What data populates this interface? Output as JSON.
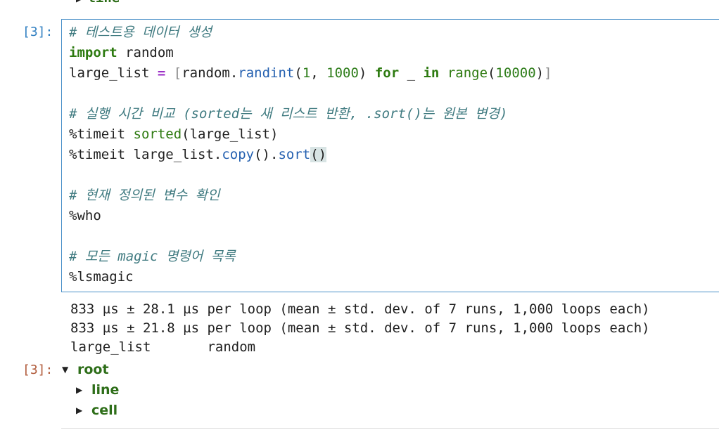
{
  "prev_output": {
    "tree_item": "line"
  },
  "input_cell": {
    "prompt": "[3]:",
    "code": {
      "l1_comment": "# 테스트용 데이터 생성",
      "l2_kw": "import",
      "l2_rest": " random",
      "l3_var": "large_list ",
      "l3_op": "=",
      "l3_a": " ",
      "l3_br_open": "[",
      "l3_b": "random.",
      "l3_fn": "randint",
      "l3_c": "(",
      "l3_n1": "1",
      "l3_d": ", ",
      "l3_n2": "1000",
      "l3_e": ") ",
      "l3_for": "for",
      "l3_f": " _ ",
      "l3_in": "in",
      "l3_g": " ",
      "l3_range": "range",
      "l3_h": "(",
      "l3_n3": "10000",
      "l3_i": ")",
      "l3_br_close": "]",
      "l5_comment": "# 실행 시간 비교 (sorted는 새 리스트 반환, .sort()는 원본 변경)",
      "l6_a": "%timeit ",
      "l6_sorted": "sorted",
      "l6_b": "(large_list)",
      "l7_a": "%timeit large_list.",
      "l7_copy": "copy",
      "l7_b": "().",
      "l7_sort": "sort",
      "l7_paren": "()",
      "l9_comment": "# 현재 정의된 변수 확인",
      "l10": "%who",
      "l12_comment": "# 모든 magic 명령어 목록",
      "l13": "%lsmagic"
    }
  },
  "output": {
    "lines": [
      "833 µs ± 28.1 µs per loop (mean ± std. dev. of 7 runs, 1,000 loops each)",
      "833 µs ± 21.8 µs per loop (mean ± std. dev. of 7 runs, 1,000 loops each)",
      "large_list\t random"
    ]
  },
  "out_cell": {
    "prompt": "[3]:",
    "tree": {
      "root": "root",
      "children": [
        "line",
        "cell"
      ]
    }
  }
}
